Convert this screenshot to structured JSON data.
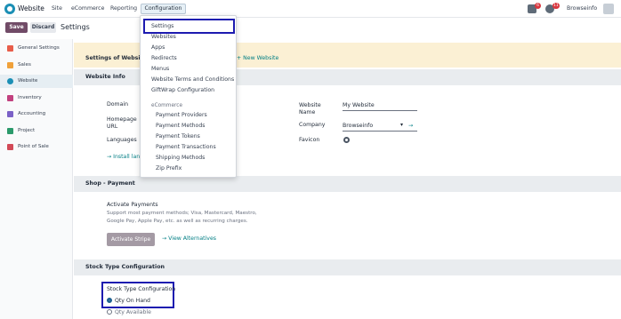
{
  "navbar": {
    "app_name": "Website",
    "menus": [
      "Site",
      "eCommerce",
      "Reporting"
    ],
    "config_label": "Configuration",
    "user": "Browseinfo",
    "badge_messages": "6",
    "badge_activities": "11"
  },
  "control": {
    "save": "Save",
    "discard": "Discard",
    "breadcrumb": "Settings"
  },
  "sidebar": {
    "items": [
      {
        "label": "General Settings",
        "color": "#e85d4a"
      },
      {
        "label": "Sales",
        "color": "#f0a13a"
      },
      {
        "label": "Website",
        "color": "#1b8fb5"
      },
      {
        "label": "Inventory",
        "color": "#c2417f"
      },
      {
        "label": "Accounting",
        "color": "#7b61c7"
      },
      {
        "label": "Project",
        "color": "#2b9a6b"
      },
      {
        "label": "Point of Sale",
        "color": "#d24a57"
      }
    ],
    "active_index": 2
  },
  "main": {
    "settings_of_website": "Settings of Website",
    "new_website": "+ New Website",
    "website_info": {
      "title": "Website Info",
      "domain_label": "Domain",
      "homepage_label": "Homepage URL",
      "languages_label": "Languages",
      "install_link": "→ Install lan",
      "website_name_label": "Website Name",
      "website_name_value": "My Website",
      "company_label": "Company",
      "company_value": "Browseinfo",
      "favicon_label": "Favicon"
    },
    "shop_payment": {
      "title": "Shop - Payment",
      "activate_payments": "Activate Payments",
      "desc_line1": "Support most payment methods; Visa, Mastercard, Maestro,",
      "desc_line2": "Google Pay, Apple Pay, etc. as well as recurring charges.",
      "activate_stripe": "Activate Stripe",
      "view_alternatives": "→ View Alternatives"
    },
    "stock_type": {
      "title": "Stock Type Configuration",
      "label": "Stock Type Configuration",
      "option_on_hand": "Qty On Hand",
      "option_available": "Qty Available",
      "selected": "Qty On Hand"
    }
  },
  "dropdown": {
    "items": [
      "Settings",
      "Websites",
      "Apps",
      "Redirects",
      "Menus",
      "Website Terms and Conditions",
      "GiftWrap Configuration"
    ],
    "ecommerce_header": "eCommerce",
    "ecommerce_items": [
      "Payment Providers",
      "Payment Methods",
      "Payment Tokens",
      "Payment Transactions",
      "Shipping Methods",
      "Zip Prefix"
    ]
  },
  "colors": {
    "brand": "#714b67",
    "accent_link": "#017e84",
    "highlight": "#1d1bb0"
  }
}
